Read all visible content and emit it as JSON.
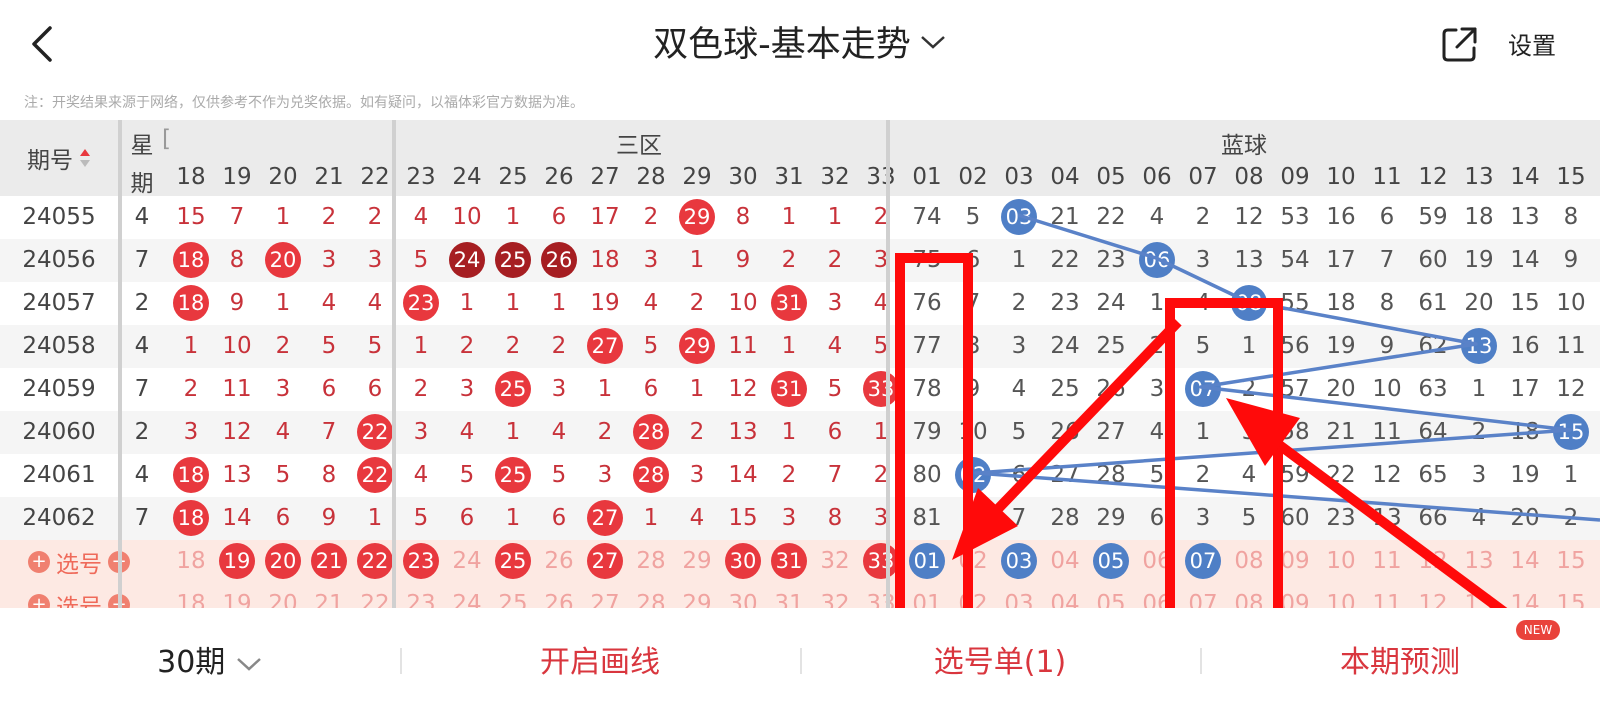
{
  "header": {
    "title": "双色球-基本走势",
    "settings_label": "设置"
  },
  "notice": "注：开奖结果来源于网络，仅供参考不作为兑奖依据。如有疑问，以福体彩官方数据为准。",
  "table": {
    "period_label": "期号",
    "week_label_top": "星",
    "week_label_bottom": "期",
    "zone_label": "三区",
    "blue_label": "蓝球",
    "red_cols": [
      "18",
      "19",
      "20",
      "21",
      "22",
      "23",
      "24",
      "25",
      "26",
      "27",
      "28",
      "29",
      "30",
      "31",
      "32",
      "33"
    ],
    "blue_cols": [
      "01",
      "02",
      "03",
      "04",
      "05",
      "06",
      "07",
      "08",
      "09",
      "10",
      "11",
      "12",
      "13",
      "14",
      "15"
    ],
    "rows": [
      {
        "period": "24055",
        "week": "4",
        "red": [
          "15",
          "7",
          "1",
          "2",
          "2",
          "4",
          "10",
          "1",
          "6",
          "17",
          "2",
          "29",
          "8",
          "1",
          "1",
          "2"
        ],
        "redHit": [
          11
        ],
        "blue": [
          "74",
          "5",
          "03",
          "21",
          "22",
          "4",
          "2",
          "12",
          "53",
          "16",
          "6",
          "59",
          "18",
          "13",
          "8"
        ],
        "blueHit": 2
      },
      {
        "period": "24056",
        "week": "7",
        "red": [
          "18",
          "8",
          "20",
          "3",
          "3",
          "5",
          "24",
          "25",
          "26",
          "18",
          "3",
          "1",
          "9",
          "2",
          "2",
          "3"
        ],
        "redHit": [
          0,
          2
        ],
        "redDark": [
          6,
          7,
          8
        ],
        "blue": [
          "75",
          "6",
          "1",
          "22",
          "23",
          "06",
          "3",
          "13",
          "54",
          "17",
          "7",
          "60",
          "19",
          "14",
          "9"
        ],
        "blueHit": 5
      },
      {
        "period": "24057",
        "week": "2",
        "red": [
          "18",
          "9",
          "1",
          "4",
          "4",
          "23",
          "1",
          "1",
          "1",
          "19",
          "4",
          "2",
          "10",
          "31",
          "3",
          "4"
        ],
        "redHit": [
          0,
          5,
          13
        ],
        "blue": [
          "76",
          "7",
          "2",
          "23",
          "24",
          "1",
          "4",
          "08",
          "55",
          "18",
          "8",
          "61",
          "20",
          "15",
          "10"
        ],
        "blueHit": 7
      },
      {
        "period": "24058",
        "week": "4",
        "red": [
          "1",
          "10",
          "2",
          "5",
          "5",
          "1",
          "2",
          "2",
          "2",
          "27",
          "5",
          "29",
          "11",
          "1",
          "4",
          "5"
        ],
        "redHit": [
          9,
          11
        ],
        "blue": [
          "77",
          "8",
          "3",
          "24",
          "25",
          "2",
          "5",
          "1",
          "56",
          "19",
          "9",
          "62",
          "13",
          "16",
          "11"
        ],
        "blueHit": 12
      },
      {
        "period": "24059",
        "week": "7",
        "red": [
          "2",
          "11",
          "3",
          "6",
          "6",
          "2",
          "3",
          "25",
          "3",
          "1",
          "6",
          "1",
          "12",
          "31",
          "5",
          "33"
        ],
        "redHit": [
          7,
          13,
          15
        ],
        "blue": [
          "78",
          "9",
          "4",
          "25",
          "26",
          "3",
          "07",
          "2",
          "57",
          "20",
          "10",
          "63",
          "1",
          "17",
          "12"
        ],
        "blueHit": 6
      },
      {
        "period": "24060",
        "week": "2",
        "red": [
          "3",
          "12",
          "4",
          "7",
          "22",
          "3",
          "4",
          "1",
          "4",
          "2",
          "28",
          "2",
          "13",
          "1",
          "6",
          "1"
        ],
        "redHit": [
          4,
          10
        ],
        "blue": [
          "79",
          "10",
          "5",
          "26",
          "27",
          "4",
          "1",
          "3",
          "58",
          "21",
          "11",
          "64",
          "2",
          "18",
          "15"
        ],
        "blueHit": 14
      },
      {
        "period": "24061",
        "week": "4",
        "red": [
          "18",
          "13",
          "5",
          "8",
          "22",
          "4",
          "5",
          "25",
          "5",
          "3",
          "28",
          "3",
          "14",
          "2",
          "7",
          "2"
        ],
        "redHit": [
          0,
          4,
          7,
          10
        ],
        "blue": [
          "80",
          "02",
          "6",
          "27",
          "28",
          "5",
          "2",
          "4",
          "59",
          "22",
          "12",
          "65",
          "3",
          "19",
          "1"
        ],
        "blueHit": 1
      },
      {
        "period": "24062",
        "week": "7",
        "red": [
          "18",
          "14",
          "6",
          "9",
          "1",
          "5",
          "6",
          "1",
          "6",
          "27",
          "1",
          "4",
          "15",
          "3",
          "8",
          "3"
        ],
        "redHit": [
          0,
          9
        ],
        "blue": [
          "81",
          "1",
          "7",
          "28",
          "29",
          "6",
          "3",
          "5",
          "60",
          "23",
          "13",
          "66",
          "4",
          "20",
          "2"
        ],
        "blueHit": -1
      }
    ],
    "select_label": "选号",
    "select_red_hit": [
      1,
      2,
      3,
      4,
      5,
      7,
      9,
      12,
      13,
      15
    ],
    "select_blue_hit": [
      0,
      2,
      4,
      6
    ]
  },
  "footer": {
    "periods": "30期",
    "draw_line": "开启画线",
    "ticket": "选号单(1)",
    "predict": "本期预测",
    "new_badge": "NEW"
  },
  "colors": {
    "red_ball": "#e8383e",
    "dark_ball": "#a61e22",
    "blue_ball": "#4f7fc6",
    "accent": "#d9363e"
  }
}
